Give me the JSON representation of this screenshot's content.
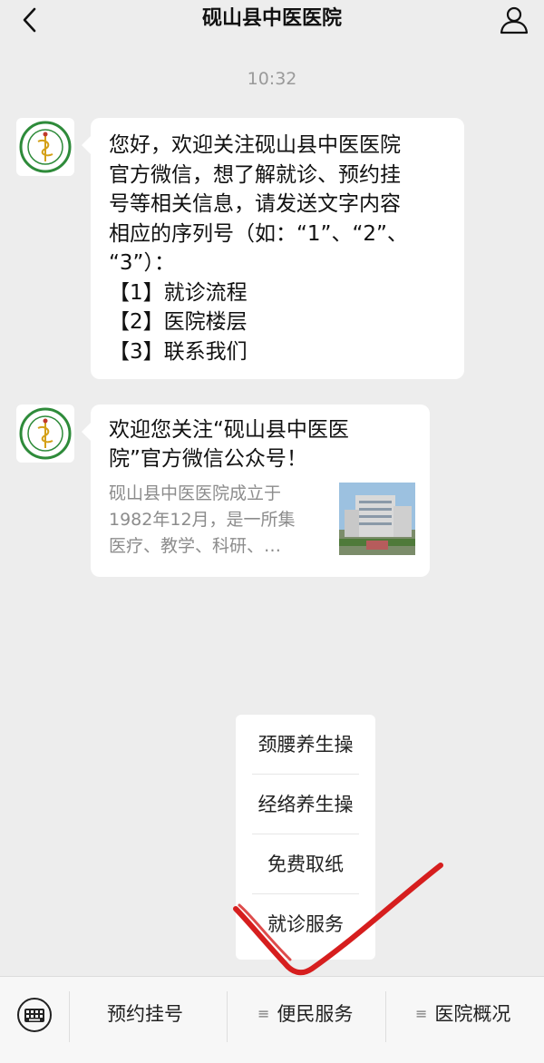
{
  "header": {
    "title": "砚山县中医医院",
    "back_icon": "chevron-left-icon",
    "user_icon": "user-icon"
  },
  "time": "10:32",
  "messages": [
    {
      "lines": [
        "您好，欢迎关注砚山县中医医院",
        "官方微信，想了解就诊、预约挂",
        "号等相关信息，请发送文字内容",
        "相应的序列号（如：“1”、“2”、",
        "“3”）：",
        "【1】就诊流程",
        "【2】医院楼层",
        "【3】联系我们"
      ]
    },
    {
      "article_title_lines": [
        "欢迎您关注“砚山县中医医",
        "院”官方微信公众号！"
      ],
      "article_desc_lines": [
        "砚山县中医医院成立于",
        "1982年12月，是一所集",
        "医疗、教学、科研、…"
      ]
    }
  ],
  "popup_menu": [
    "颈腰养生操",
    "经络养生操",
    "免费取纸",
    "就诊服务"
  ],
  "bottom_bar": {
    "keyboard_icon": "keyboard-icon",
    "items": [
      "预约挂号",
      "便民服务",
      "医院概况"
    ]
  },
  "colors": {
    "background": "#ededed",
    "bubble": "#ffffff",
    "annotation": "#d61e1e",
    "logo_green": "#2e8b3a"
  }
}
